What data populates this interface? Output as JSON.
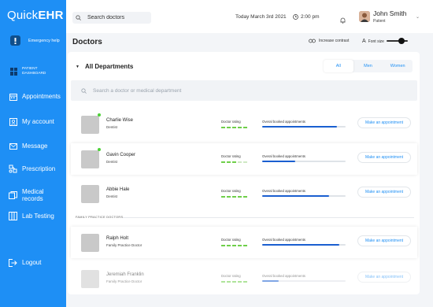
{
  "app": {
    "logo_prefix": "Quick",
    "logo_suffix": "EHR"
  },
  "sidebar": {
    "emergency": "Emergency help",
    "patient_dashboard": "PATIENT DASHBOARD",
    "items": [
      {
        "label": "Appointments",
        "icon": "calendar-icon"
      },
      {
        "label": "My account",
        "icon": "user-icon"
      },
      {
        "label": "Message",
        "icon": "envelope-icon"
      },
      {
        "label": "Prescription",
        "icon": "prescription-icon"
      },
      {
        "label": "Medical records",
        "icon": "records-icon"
      },
      {
        "label": "Lab Testing",
        "icon": "lab-icon"
      }
    ],
    "logout": "Logout"
  },
  "topbar": {
    "search_placeholder": "Search doctors",
    "date": "Today March 3rd 2021",
    "time": "2:00 pm",
    "user_name": "John Smith",
    "user_role": "Patient"
  },
  "main": {
    "title": "Doctors",
    "increase_contrast": "Increase contrast",
    "font_size": "Font size",
    "department": "All Departments",
    "filters": [
      "All",
      "Men",
      "Women"
    ],
    "search_placeholder": "Search a doctor or medical department",
    "rating_label": "Doctor rating",
    "booked_label": "Overal booked appointments",
    "button_label": "Make an appointment",
    "section_label": "FAMILY PRACTICE DOCTORS"
  },
  "doctors": [
    {
      "name": "Charlie Wise",
      "specialty": "Dentist",
      "rating": 5,
      "booked": 0.9,
      "online": true
    },
    {
      "name": "Gavin Cooper",
      "specialty": "Dentist",
      "rating": 3,
      "booked": 0.4,
      "online": true
    },
    {
      "name": "Abbie Hale",
      "specialty": "Dentist",
      "rating": 5,
      "booked": 0.8,
      "online": false
    },
    {
      "name": "Ralph Holt",
      "specialty": "Family Practice Doctor",
      "rating": 5,
      "booked": 0.92,
      "online": false
    },
    {
      "name": "Jeremiah Franklin",
      "specialty": "Family Practice Doctor",
      "rating": 5,
      "booked": 0.2,
      "online": false
    }
  ],
  "colors": {
    "primary": "#1e8ff5",
    "bar": "#1a5fd0",
    "star": "#6fcf4a",
    "online": "#4cd137"
  }
}
